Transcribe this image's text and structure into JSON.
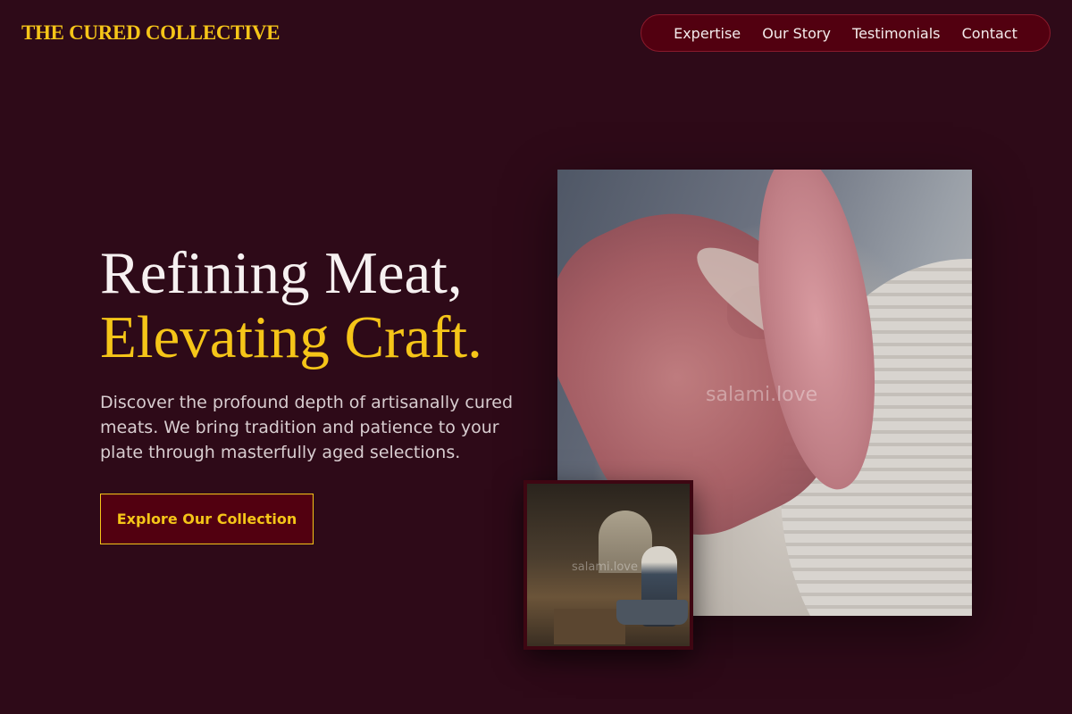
{
  "brand": {
    "name": "THE CURED COLLECTIVE"
  },
  "nav": {
    "items": [
      {
        "label": "Expertise"
      },
      {
        "label": "Our Story"
      },
      {
        "label": "Testimonials"
      },
      {
        "label": "Contact"
      }
    ]
  },
  "hero": {
    "title_line1": "Refining Meat,",
    "title_line2": "Elevating Craft.",
    "subtitle": "Discover the profound depth of artisanally cured meats. We bring tradition and patience to your plate through masterfully aged selections.",
    "cta_label": "Explore Our Collection"
  },
  "images": {
    "main_watermark": "salami.love",
    "inset_watermark": "salami.love"
  },
  "colors": {
    "background": "#2e0a18",
    "accent": "#f5c518",
    "nav_bg": "#520010"
  }
}
